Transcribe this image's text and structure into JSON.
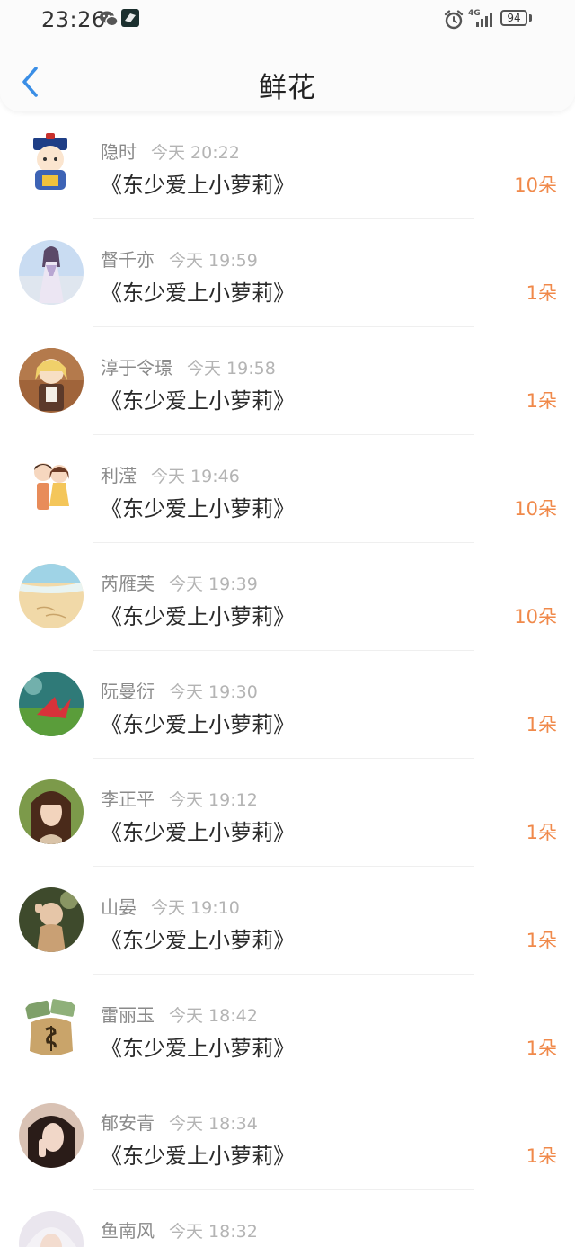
{
  "status_bar": {
    "time": "23:26",
    "network": "4G",
    "battery": "94"
  },
  "header": {
    "title": "鲜花"
  },
  "records": [
    {
      "user": "隐时",
      "time": "今天 20:22",
      "book": "《东少爱上小萝莉》",
      "count": "10朵"
    },
    {
      "user": "督千亦",
      "time": "今天 19:59",
      "book": "《东少爱上小萝莉》",
      "count": "1朵"
    },
    {
      "user": "淳于令璟",
      "time": "今天 19:58",
      "book": "《东少爱上小萝莉》",
      "count": "1朵"
    },
    {
      "user": "利滢",
      "time": "今天 19:46",
      "book": "《东少爱上小萝莉》",
      "count": "10朵"
    },
    {
      "user": "芮雁芙",
      "time": "今天 19:39",
      "book": "《东少爱上小萝莉》",
      "count": "10朵"
    },
    {
      "user": "阮曼衍",
      "time": "今天 19:30",
      "book": "《东少爱上小萝莉》",
      "count": "1朵"
    },
    {
      "user": "李正平",
      "time": "今天 19:12",
      "book": "《东少爱上小萝莉》",
      "count": "1朵"
    },
    {
      "user": "山晏",
      "time": "今天 19:10",
      "book": "《东少爱上小萝莉》",
      "count": "1朵"
    },
    {
      "user": "雷丽玉",
      "time": "今天 18:42",
      "book": "《东少爱上小萝莉》",
      "count": "1朵"
    },
    {
      "user": "郁安青",
      "time": "今天 18:34",
      "book": "《东少爱上小萝莉》",
      "count": "1朵"
    },
    {
      "user": "鱼南风",
      "time": "今天 18:32",
      "book": "",
      "count": ""
    }
  ],
  "colors": {
    "accent_back": "#3a8ee6",
    "flower_count": "#f0894a",
    "username": "#8a8a8a",
    "timestamp": "#b4b4b4"
  }
}
